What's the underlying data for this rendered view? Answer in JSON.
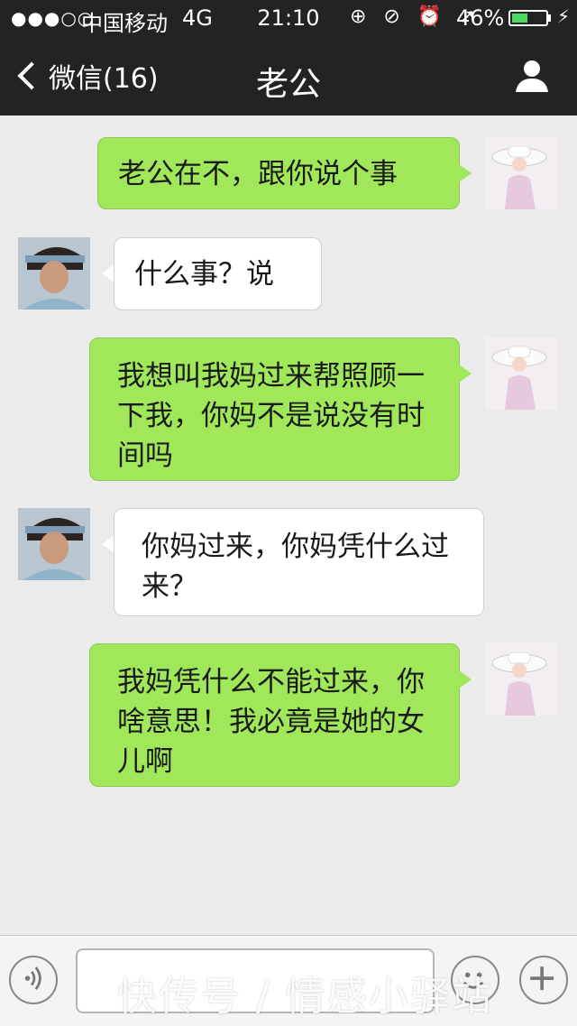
{
  "status_bar": {
    "signal": "●●●○○",
    "carrier": "中国移动",
    "network": "4G",
    "time": "21:10",
    "icons": "⊕ ⊘ ⏰ ➚",
    "battery": "46%",
    "battery_level": 0.46,
    "charging": "⚡"
  },
  "nav": {
    "back_label": "微信(16)",
    "title": "老公"
  },
  "messages": [
    {
      "side": "right",
      "text": "老公在不，跟你说个事"
    },
    {
      "side": "left",
      "text": "什么事？说"
    },
    {
      "side": "right",
      "text": "我想叫我妈过来帮照顾一下我，你妈不是说没有时间吗"
    },
    {
      "side": "left",
      "text": "你妈过来，你妈凭什么过来？"
    },
    {
      "side": "right",
      "text": "我妈凭什么不能过来，你啥意思！我必竟是她的女儿啊"
    }
  ],
  "input_bar": {
    "voice_icon": "voice-icon",
    "emoji_icon": "emoji-icon",
    "plus_icon": "plus-icon"
  },
  "watermark": "快传号 / 情感小驿站",
  "colors": {
    "bar_bg": "#232323",
    "chat_bg": "#ebebeb",
    "bubble_sent": "#a0e75a",
    "bubble_received": "#ffffff"
  }
}
